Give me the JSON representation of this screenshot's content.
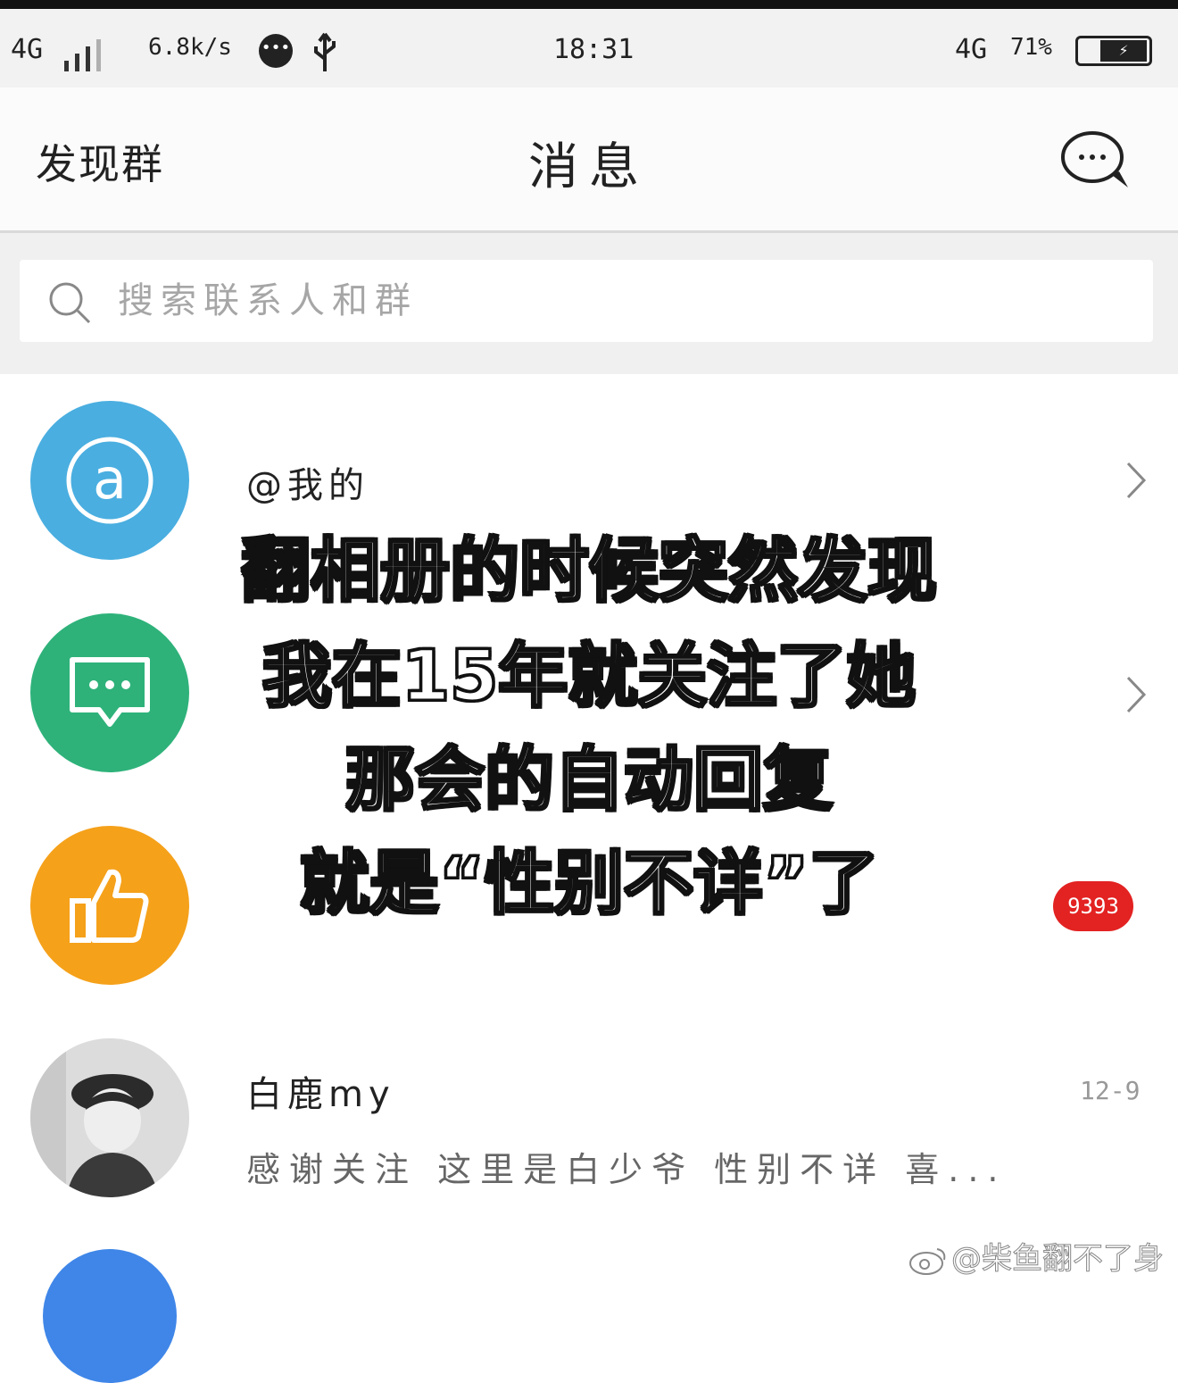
{
  "status_bar": {
    "network": "4G",
    "speed": "6.8k/s",
    "time": "18:31",
    "network_right": "4G",
    "battery": "71%"
  },
  "nav": {
    "left_label": "发现群",
    "title": "消息"
  },
  "search": {
    "placeholder": "搜索联系人和群"
  },
  "rows": [
    {
      "title": "@我的",
      "color": "#4aaee0",
      "icon": "at-icon"
    },
    {
      "title": "",
      "color": "#2eb27a",
      "icon": "chat-bubble-icon"
    },
    {
      "title": "",
      "color": "#f5a11a",
      "icon": "thumbs-up-icon",
      "badge": "9393"
    },
    {
      "title": "白鹿my",
      "subtitle": "感谢关注 这里是白少爷 性别不详 喜...",
      "time": "12-9",
      "icon": "avatar-photo"
    }
  ],
  "overlay_caption": [
    "翻相册的时候突然发现",
    "我在15年就关注了她",
    "那会的自动回复",
    "就是“性别不详”了"
  ],
  "watermark": "@柴鱼翻不了身"
}
